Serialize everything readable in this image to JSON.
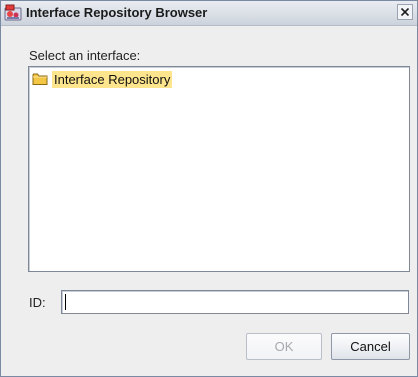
{
  "window": {
    "title": "Interface Repository Browser",
    "close_glyph": "X",
    "icon": "app-icon"
  },
  "tree": {
    "prompt": "Select an interface:",
    "root_label": "Interface Repository",
    "root_icon": "folder-icon",
    "selection_color": "#fde58d"
  },
  "id_field": {
    "label": "ID:",
    "value": ""
  },
  "buttons": {
    "ok_label": "OK",
    "ok_enabled": false,
    "cancel_label": "Cancel"
  }
}
